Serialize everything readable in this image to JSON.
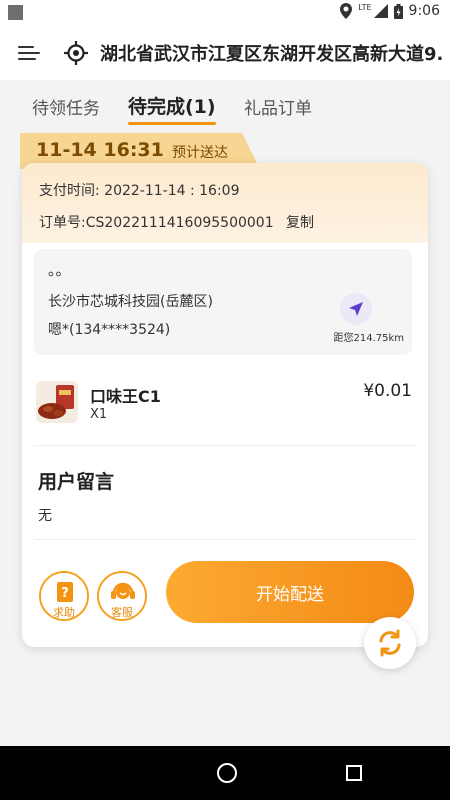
{
  "status_bar": {
    "time": "9:06",
    "network": "LTE"
  },
  "header": {
    "address": "湖北省武汉市江夏区东湖开发区高新大道9..."
  },
  "tabs": [
    {
      "label": "待领任务",
      "active": false
    },
    {
      "label": "待完成(1)",
      "active": true
    },
    {
      "label": "礼品订单",
      "active": false
    }
  ],
  "order": {
    "deliver_time": "11-14 16:31",
    "eta_label": "预计送达",
    "pay_time": "支付时间: 2022-11-14 : 16:09",
    "order_no": "订单号:CS2022111416095500001",
    "copy_label": "复制",
    "address": {
      "dots": "。。",
      "location": "长沙市芯城科技园(岳麓区)",
      "contact": "嗯*(134****3524)",
      "distance": "距您214.75km"
    },
    "item": {
      "name": "口味王C1",
      "qty": "X1",
      "price": "¥0.01"
    },
    "message": {
      "title": "用户留言",
      "body": "无"
    }
  },
  "actions": {
    "help_label": "求助",
    "service_label": "客服",
    "start_label": "开始配送"
  },
  "colors": {
    "accent": "#f39410",
    "tag_bg": "#f7d592",
    "button_start": "#fbaa30",
    "button_end": "#f48a16"
  }
}
